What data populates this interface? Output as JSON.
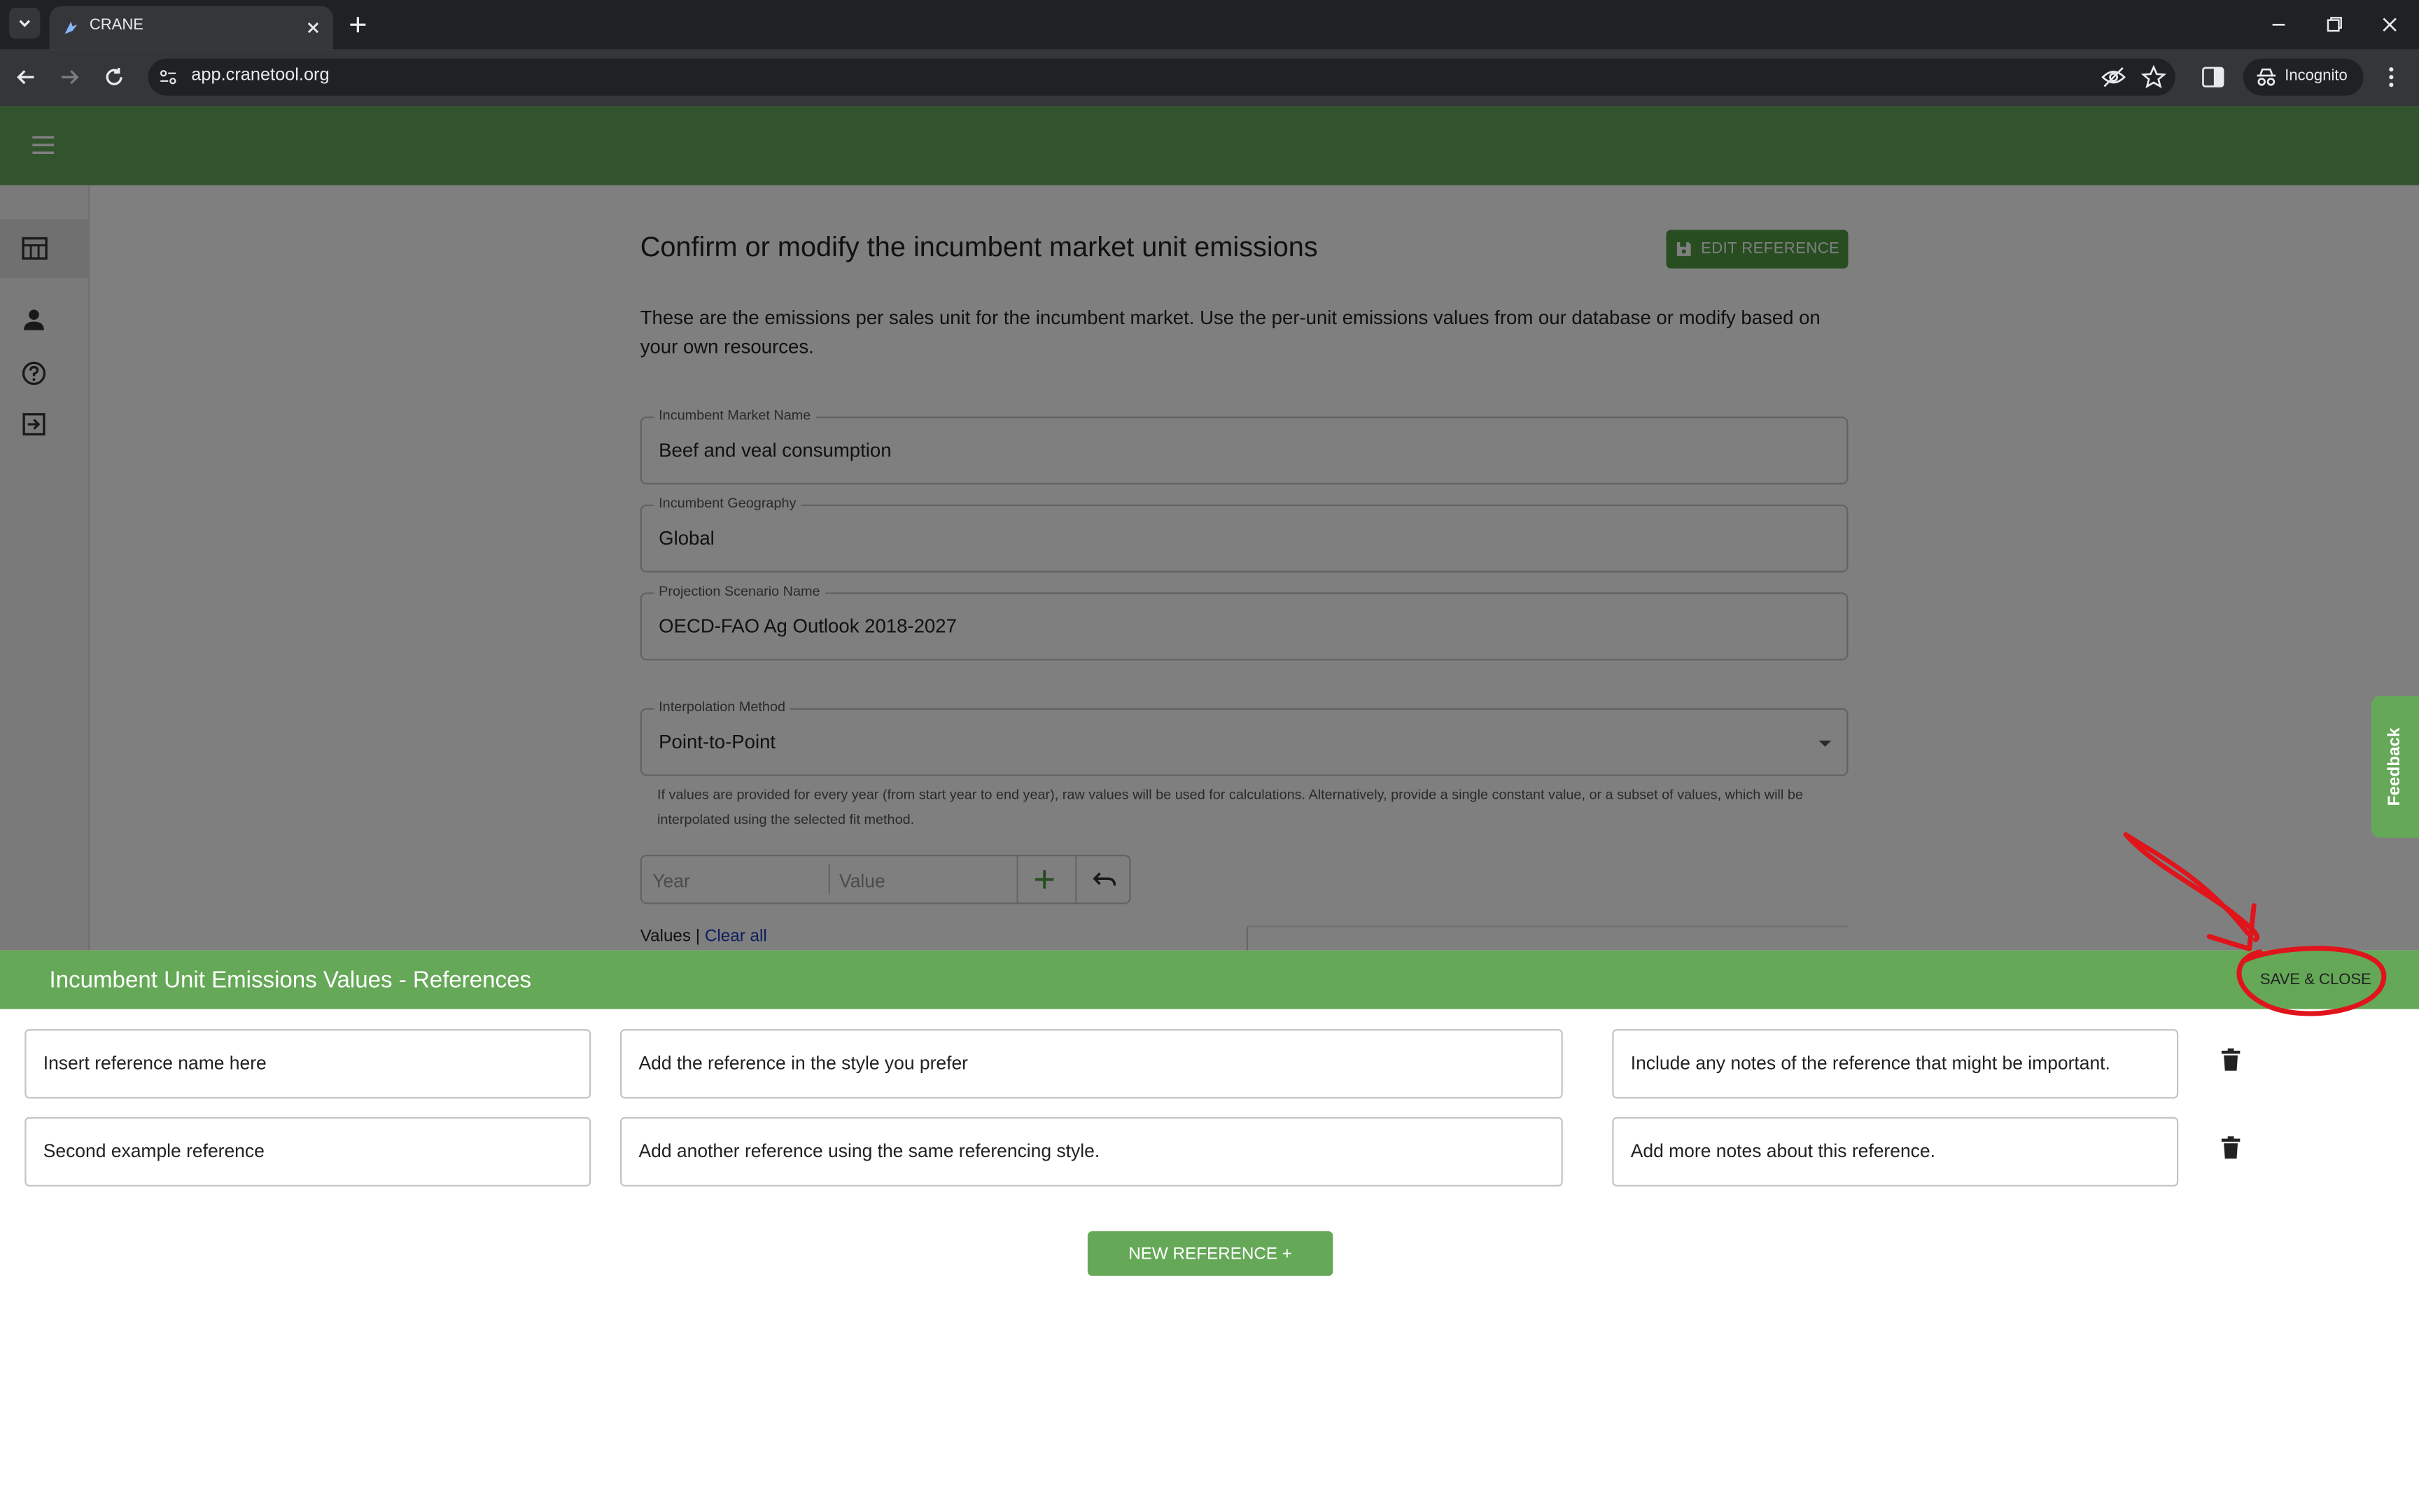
{
  "browser": {
    "tab_title": "CRANE",
    "url": "app.cranetool.org",
    "incognito_label": "Incognito"
  },
  "page": {
    "title": "Confirm or modify the incumbent market unit emissions",
    "edit_reference_label": "EDIT REFERENCE",
    "description": "These are the emissions per sales unit for the incumbent market. Use the per-unit emissions values from our database or modify based on your own resources.",
    "fields": [
      {
        "label": "Incumbent Market Name",
        "value": "Beef and veal consumption"
      },
      {
        "label": "Incumbent Geography",
        "value": "Global"
      },
      {
        "label": "Projection Scenario Name",
        "value": "OECD-FAO Ag Outlook 2018-2027"
      }
    ],
    "interpolation": {
      "label": "Interpolation Method",
      "value": "Point-to-Point",
      "helper": "If values are provided for every year (from start year to end year), raw values will be used for calculations. Alternatively, provide a single constant value, or a subset of values, which will be interpolated using the selected fit method."
    },
    "year_placeholder": "Year",
    "value_placeholder": "Value",
    "values_label": "Values",
    "values_separator": " | ",
    "clear_all": "Clear all",
    "feedback_label": "Feedback"
  },
  "sidebar": {
    "icons": [
      "table-icon",
      "person-icon",
      "help-icon",
      "logout-icon"
    ]
  },
  "references_panel": {
    "title": "Incumbent Unit Emissions Values - References",
    "save_close_label": "SAVE & CLOSE",
    "rows": [
      {
        "name": "Insert reference name here",
        "reference": "Add the reference in the style you prefer",
        "notes": "Include any notes of the reference that might be important."
      },
      {
        "name": "Second example reference",
        "reference": "Add another reference using the same referencing style.",
        "notes": "Add more notes about this reference."
      }
    ],
    "new_reference_label": "NEW REFERENCE +"
  },
  "colors": {
    "brand_green": "#65a858",
    "annotation_red": "#e0141b"
  }
}
